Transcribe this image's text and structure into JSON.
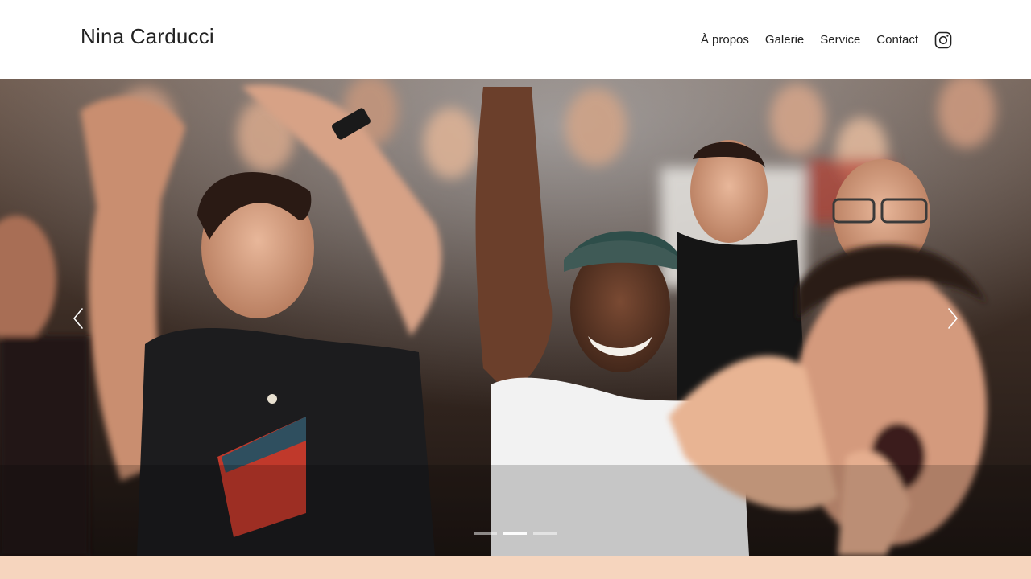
{
  "brand": {
    "name": "Nina Carducci"
  },
  "nav": {
    "items": [
      {
        "label": "À propos"
      },
      {
        "label": "Galerie"
      },
      {
        "label": "Service"
      },
      {
        "label": "Contact"
      }
    ],
    "instagram_icon": "instagram-icon"
  },
  "carousel": {
    "slide_count": 3,
    "active_index": 1,
    "prev_icon": "chevron-left-icon",
    "next_icon": "chevron-right-icon"
  },
  "colors": {
    "text": "#222222",
    "footer_band": "#f6d5be",
    "indicator": "#ffffff"
  }
}
